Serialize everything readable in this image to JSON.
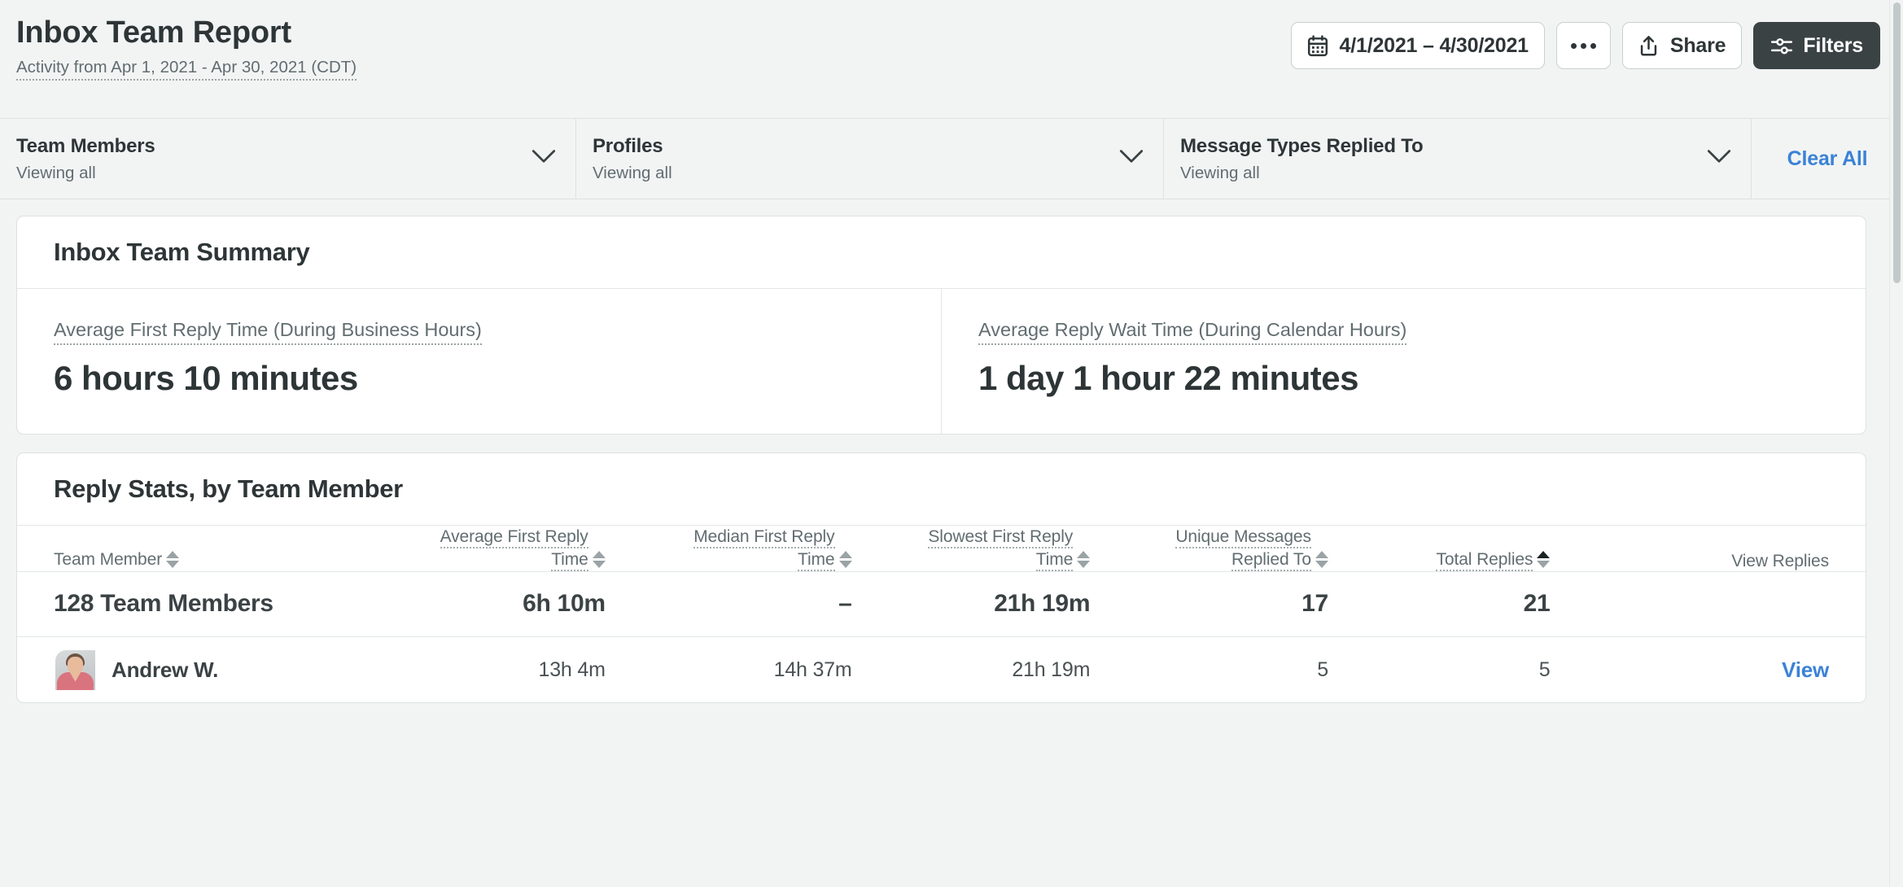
{
  "header": {
    "title": "Inbox Team Report",
    "subtitle": "Activity from Apr 1, 2021 - Apr 30, 2021 (CDT)",
    "toolbar": {
      "date_range": "4/1/2021 – 4/30/2021",
      "date_icon": "calendar-icon",
      "more_icon": "ellipsis-icon",
      "share_label": "Share",
      "share_icon": "share-upload-icon",
      "filters_label": "Filters",
      "filters_icon": "sliders-icon",
      "filters_bg": "#3b4244"
    }
  },
  "filter_bar": {
    "filters": [
      {
        "label": "Team Members",
        "value": "Viewing all",
        "chevron": "chevron-down-icon"
      },
      {
        "label": "Profiles",
        "value": "Viewing all",
        "chevron": "chevron-down-icon"
      },
      {
        "label": "Message Types Replied To",
        "value": "Viewing all",
        "chevron": "chevron-down-icon"
      }
    ],
    "clear_all": "Clear All",
    "link_color": "#3b82d6"
  },
  "summary_card": {
    "title": "Inbox Team Summary",
    "metrics": [
      {
        "label": "Average First Reply Time (During Business Hours)",
        "value": "6 hours 10 minutes"
      },
      {
        "label": "Average Reply Wait Time (During Calendar Hours)",
        "value": "1 day 1 hour 22 minutes"
      }
    ]
  },
  "table_card": {
    "title": "Reply Stats, by Team Member",
    "columns": [
      {
        "line1": "Team Member",
        "line2": "",
        "sortable": true,
        "sort_active": false
      },
      {
        "line1": "Average First Reply",
        "line2": "Time",
        "sortable": true,
        "sort_active": false
      },
      {
        "line1": "Median First Reply",
        "line2": "Time",
        "sortable": true,
        "sort_active": false
      },
      {
        "line1": "Slowest First Reply",
        "line2": "Time",
        "sortable": true,
        "sort_active": false
      },
      {
        "line1": "Unique Messages",
        "line2": "Replied To",
        "sortable": true,
        "sort_active": false
      },
      {
        "line1": "Total Replies",
        "line2": "",
        "sortable": true,
        "sort_active": true
      },
      {
        "line1": "View Replies",
        "line2": "",
        "sortable": false,
        "sort_active": false
      }
    ],
    "summary_row": {
      "member": "128 Team Members",
      "avg_first_reply_time": "6h 10m",
      "median_first_reply_time": "–",
      "slowest_first_reply_time": "21h 19m",
      "unique_messages_replied_to": "17",
      "total_replies": "21",
      "view": ""
    },
    "rows": [
      {
        "member": "Andrew W.",
        "avatar": "user-photo-avatar",
        "avg_first_reply_time": "13h 4m",
        "median_first_reply_time": "14h 37m",
        "slowest_first_reply_time": "21h 19m",
        "unique_messages_replied_to": "5",
        "total_replies": "5",
        "view": "View"
      }
    ]
  }
}
